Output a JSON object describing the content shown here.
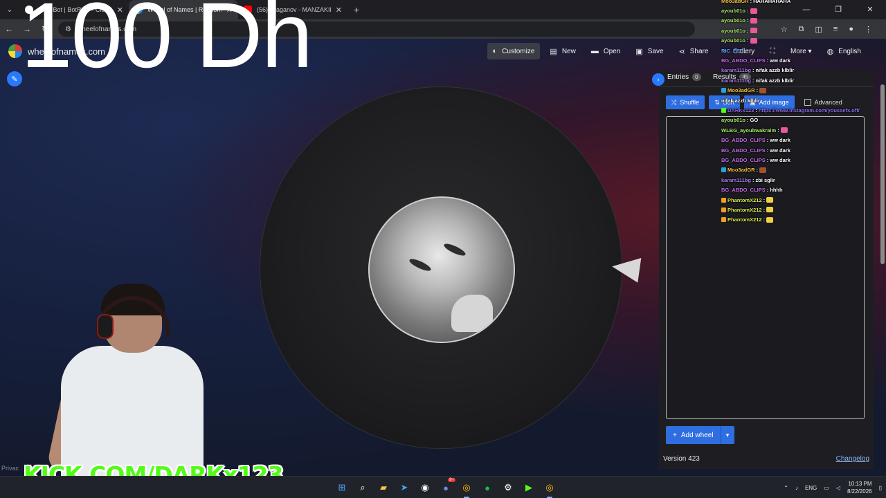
{
  "browser": {
    "tabs": [
      {
        "title": "Chat Bot | BotRix — Cloud Stre",
        "favicon_color": "#ffffff",
        "active": false
      },
      {
        "title": "Wheel of Names | Random nam",
        "favicon_color": "#e53935",
        "active": true
      },
      {
        "title": "(56) Draganov - MANZAKINE f",
        "favicon_color": "#ff0000",
        "active": false
      }
    ],
    "new_tab": "+",
    "url": "wheelofnames.com"
  },
  "site": {
    "brand": "wheelofnames.com",
    "menu": [
      {
        "icon": "palette-icon",
        "glyph": "◐",
        "label": "Customize",
        "hover": true
      },
      {
        "icon": "new-file-icon",
        "glyph": "▤",
        "label": "New"
      },
      {
        "icon": "folder-icon",
        "glyph": "▬",
        "label": "Open"
      },
      {
        "icon": "save-icon",
        "glyph": "▣",
        "label": "Save"
      },
      {
        "icon": "share-icon",
        "glyph": "⋖",
        "label": "Share"
      },
      {
        "icon": "gallery-icon",
        "glyph": "⌕",
        "label": "Gallery"
      },
      {
        "icon": "fullscreen-icon",
        "glyph": "⛶",
        "label": ""
      },
      {
        "icon": "more-icon",
        "glyph": "",
        "label": "More ▾"
      },
      {
        "icon": "globe-icon",
        "glyph": "◍",
        "label": "English"
      }
    ],
    "overlay_text": "100 Dh"
  },
  "panel": {
    "tabs": [
      {
        "label": "Entries",
        "count": "0"
      },
      {
        "label": "Results",
        "count": "45"
      }
    ],
    "shuffle": "Shuffle",
    "sort": "Sort",
    "add_image": "Add image",
    "advanced": "Advanced",
    "add_wheel": "Add wheel",
    "version": "Version 423",
    "changelog": "Changelog"
  },
  "chat": [
    {
      "user": "Moo3adGR",
      "color": "#f0c040",
      "badge": "",
      "msg": "HAHAHAHAHA"
    },
    {
      "user": "ayoub01o",
      "color": "#a8e86a",
      "badge": "",
      "msg": "",
      "emote": "#e85a9a"
    },
    {
      "user": "ayoub01o",
      "color": "#a8e86a",
      "badge": "",
      "msg": "",
      "emote": "#e85a9a"
    },
    {
      "user": "ayoub01o",
      "color": "#a8e86a",
      "badge": "",
      "msg": "",
      "emote": "#e85a9a"
    },
    {
      "user": "ayoub01o",
      "color": "#a8e86a",
      "badge": "",
      "msg": "",
      "emote": "#e85a9a"
    },
    {
      "user": "RIC_FFF",
      "color": "#5aa0ff",
      "badge": "",
      "msg": ""
    },
    {
      "user": "BG_ABDO_CLIPS",
      "color": "#c46ae8",
      "badge": "",
      "msg": "ww dark"
    },
    {
      "user": "karam111bg",
      "color": "#a878e8",
      "badge": "",
      "msg": "nifak azzb klblir"
    },
    {
      "user": "karam111bg",
      "color": "#a878e8",
      "badge": "",
      "msg": "nifak azzb klblir"
    },
    {
      "user": "Moo3adGR",
      "color": "#f0c040",
      "badge": "#2aa0d8",
      "msg": "",
      "emote": "#a0522d"
    },
    {
      "user": "",
      "color": "#a878e8",
      "badge": "",
      "msg": "nifak azzb klblir"
    },
    {
      "user": "DARKx123",
      "color": "#8a6ae8",
      "badge": "#53fc18",
      "msg": "https://www.instagram.com/youssefx.off/",
      "msg_color": "#8a6ae8"
    },
    {
      "user": "ayoub01o",
      "color": "#a8e86a",
      "badge": "",
      "msg": "GO"
    },
    {
      "user": "WLBG_ayoubwakraim",
      "color": "#a8e86a",
      "badge": "",
      "msg": "",
      "emote": "#e85a9a"
    },
    {
      "user": "BG_ABDO_CLIPS",
      "color": "#c46ae8",
      "badge": "",
      "msg": "ww dark"
    },
    {
      "user": "BG_ABDO_CLIPS",
      "color": "#c46ae8",
      "badge": "",
      "msg": "ww dark"
    },
    {
      "user": "BG_ABDO_CLIPS",
      "color": "#c46ae8",
      "badge": "",
      "msg": "ww dark"
    },
    {
      "user": "Moo3adGR",
      "color": "#f0c040",
      "badge": "#2aa0d8",
      "msg": "",
      "emote": "#a0522d"
    },
    {
      "user": "karam111bg",
      "color": "#a878e8",
      "badge": "",
      "msg": "zbi sglir"
    },
    {
      "user": "BG_ABDO_CLIPS",
      "color": "#c46ae8",
      "badge": "",
      "msg": "hhhh"
    },
    {
      "user": "PhantomX212",
      "color": "#d8e84a",
      "badge": "#f0a020",
      "msg": "",
      "emote": "#f0d040"
    },
    {
      "user": "PhantomX212",
      "color": "#d8e84a",
      "badge": "#f0a020",
      "msg": "",
      "emote": "#f0d040"
    },
    {
      "user": "PhantomX212",
      "color": "#d8e84a",
      "badge": "#f0a020",
      "msg": "",
      "emote": "#f0d040"
    }
  ],
  "stream": {
    "kick_label": "KICK.COM/DARKx123",
    "privacy": "Privac"
  },
  "taskbar": {
    "lang": "ENG",
    "time": "10:13 PM",
    "date": "8/22/2026"
  },
  "colors": {
    "accent": "#2979ff",
    "button": "#2f6ee0",
    "kick_green": "#53fc18"
  }
}
